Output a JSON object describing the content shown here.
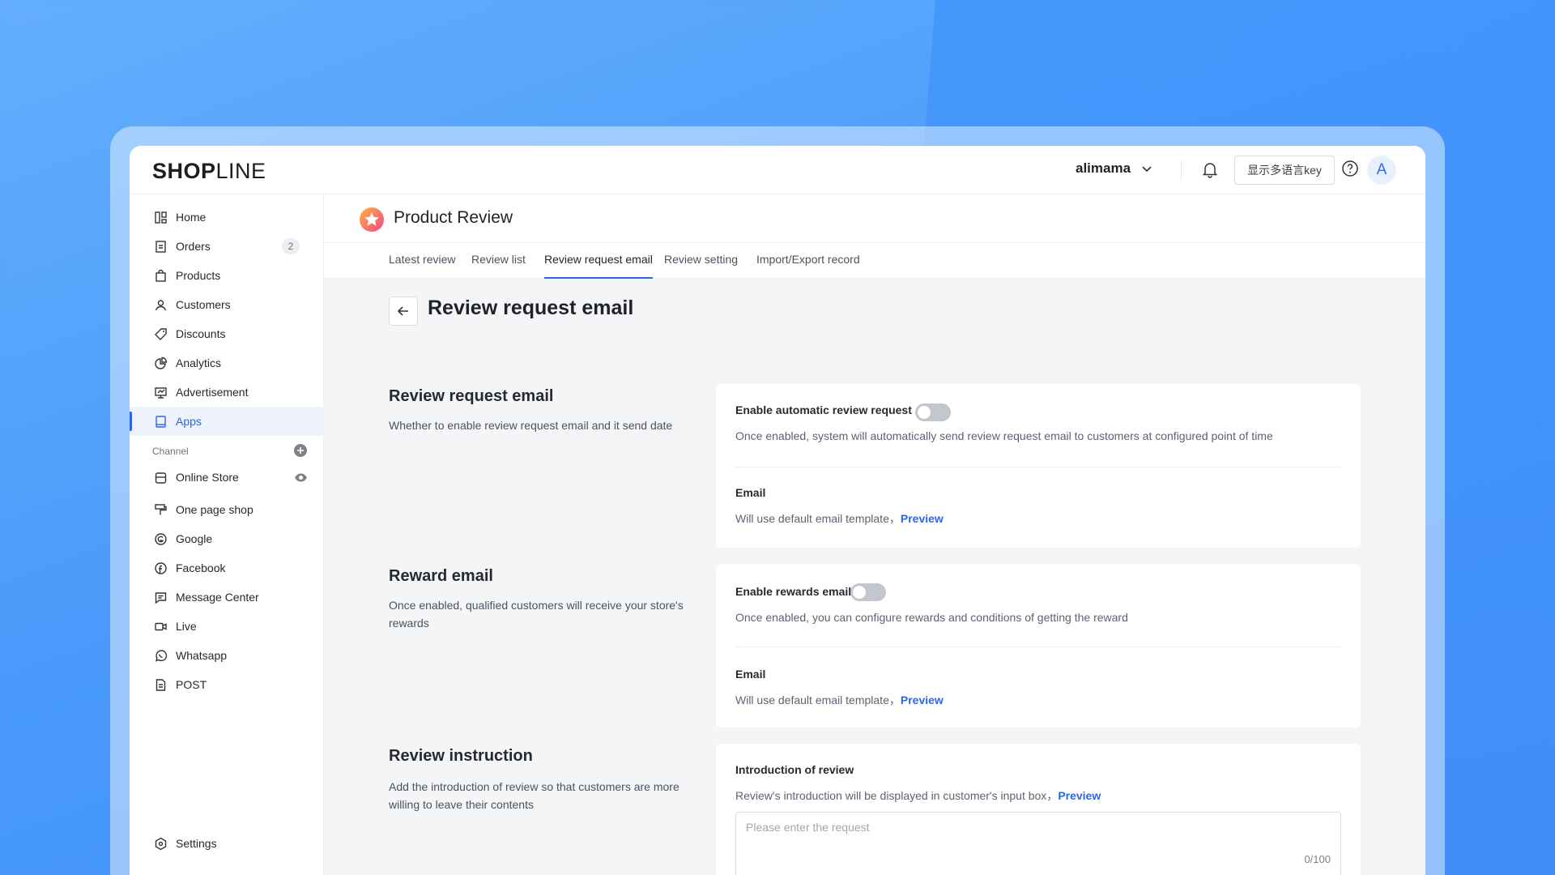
{
  "topbar": {
    "logo_bold": "SHOP",
    "logo_light": "LINE",
    "store_name": "alimama",
    "lang_button": "显示多语言key",
    "avatar_letter": "A"
  },
  "sidebar": {
    "items": [
      {
        "label": "Home",
        "icon": "home-icon"
      },
      {
        "label": "Orders",
        "icon": "orders-icon",
        "badge": "2"
      },
      {
        "label": "Products",
        "icon": "bag-icon"
      },
      {
        "label": "Customers",
        "icon": "user-icon"
      },
      {
        "label": "Discounts",
        "icon": "tag-icon"
      },
      {
        "label": "Analytics",
        "icon": "pie-icon"
      },
      {
        "label": "Advertisement",
        "icon": "monitor-icon"
      },
      {
        "label": "Apps",
        "icon": "apps-icon",
        "active": true
      }
    ],
    "channel_label": "Channel",
    "channels": [
      {
        "label": "Online Store",
        "icon": "store-icon"
      },
      {
        "label": "One page shop",
        "icon": "brush-icon"
      },
      {
        "label": "Google",
        "icon": "google-icon"
      },
      {
        "label": "Facebook",
        "icon": "facebook-icon"
      },
      {
        "label": "Message Center",
        "icon": "chat-icon"
      },
      {
        "label": "Live",
        "icon": "video-icon"
      },
      {
        "label": "Whatsapp",
        "icon": "whatsapp-icon"
      },
      {
        "label": "POST",
        "icon": "receipt-icon"
      }
    ],
    "settings": "Settings"
  },
  "header": {
    "app_title": "Product Review"
  },
  "tabs": [
    {
      "label": "Latest review"
    },
    {
      "label": "Review list"
    },
    {
      "label": "Review request email",
      "active": true
    },
    {
      "label": "Review setting"
    },
    {
      "label": "Import/Export record"
    }
  ],
  "page_title": "Review request email",
  "sections": {
    "request": {
      "title": "Review request email",
      "desc": "Whether to enable review request email and it send date",
      "toggle_label": "Enable automatic review request",
      "toggle_desc": "Once enabled, system will automatically send review request email to customers at configured point of time",
      "email_label": "Email",
      "email_desc": "Will use default email template，",
      "preview": "Preview"
    },
    "reward": {
      "title": "Reward email",
      "desc": "Once enabled, qualified customers will receive your store's rewards",
      "toggle_label": "Enable rewards email",
      "toggle_desc": "Once enabled, you can configure rewards and conditions of getting the reward",
      "email_label": "Email",
      "email_desc": "Will use default email template，",
      "preview": "Preview"
    },
    "instruction": {
      "title": "Review instruction",
      "desc": "Add the introduction of review so that customers are more willing to leave their contents",
      "intro_label": "Introduction of review",
      "intro_desc": "Review's introduction will be displayed in customer's input box，",
      "preview": "Preview",
      "placeholder": "Please enter the request",
      "counter": "0/100"
    }
  },
  "colors": {
    "accent": "#2f65e0",
    "background": "#4a9bfb"
  }
}
